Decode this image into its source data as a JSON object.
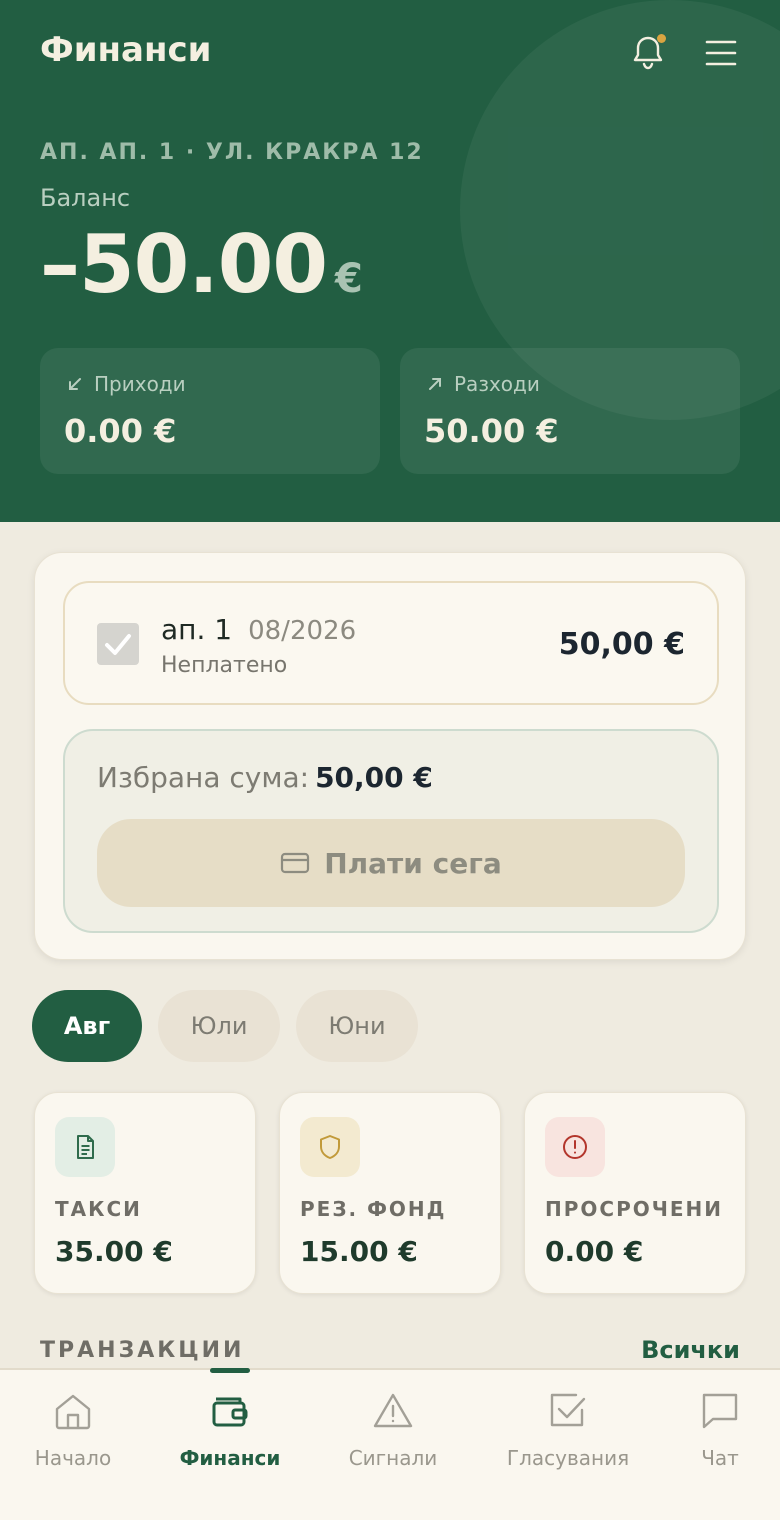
{
  "header": {
    "title": "Финанси",
    "address": "АП. АП. 1 · УЛ. КРАКРА 12",
    "balance_label": "Баланс",
    "balance_amount": "–50.00",
    "balance_currency": "€"
  },
  "stats": {
    "income": {
      "label": "Приходи",
      "value": "0.00 €"
    },
    "expense": {
      "label": "Разходи",
      "value": "50.00 €"
    }
  },
  "invoice": {
    "apartment": "ап. 1",
    "period": "08/2026",
    "status": "Неплатено",
    "amount": "50,00 €",
    "checked": true
  },
  "summary": {
    "label": "Избрана сума:",
    "value": "50,00 €",
    "pay_label": "Плати сега"
  },
  "month_tabs": [
    {
      "label": "Авг",
      "active": true
    },
    {
      "label": "Юли",
      "active": false
    },
    {
      "label": "Юни",
      "active": false
    }
  ],
  "categories": [
    {
      "label": "ТАКСИ",
      "value": "35.00 €",
      "icon": "document-icon",
      "icon_color": "#2f6b4c",
      "icon_bg": "#e3eee5"
    },
    {
      "label": "РЕЗ. ФОНД",
      "value": "15.00 €",
      "icon": "shield-icon",
      "icon_color": "#c19a3a",
      "icon_bg": "#f3ead0"
    },
    {
      "label": "ПРОСРОЧЕНИ",
      "value": "0.00 €",
      "icon": "alert-circle-icon",
      "icon_color": "#b3362c",
      "icon_bg": "#f8e4df"
    }
  ],
  "transactions": {
    "title": "ТРАНЗАКЦИИ",
    "all_label": "Всички"
  },
  "nav": [
    {
      "label": "Начало",
      "icon": "home-icon",
      "active": false
    },
    {
      "label": "Финанси",
      "icon": "wallet-icon",
      "active": true
    },
    {
      "label": "Сигнали",
      "icon": "warning-icon",
      "active": false
    },
    {
      "label": "Гласувания",
      "icon": "checkbox-icon",
      "active": false
    },
    {
      "label": "Чат",
      "icon": "chat-icon",
      "active": false
    }
  ],
  "colors": {
    "brand_green": "#225e42",
    "notification_dot": "#d9a441",
    "background": "#efebe0"
  }
}
